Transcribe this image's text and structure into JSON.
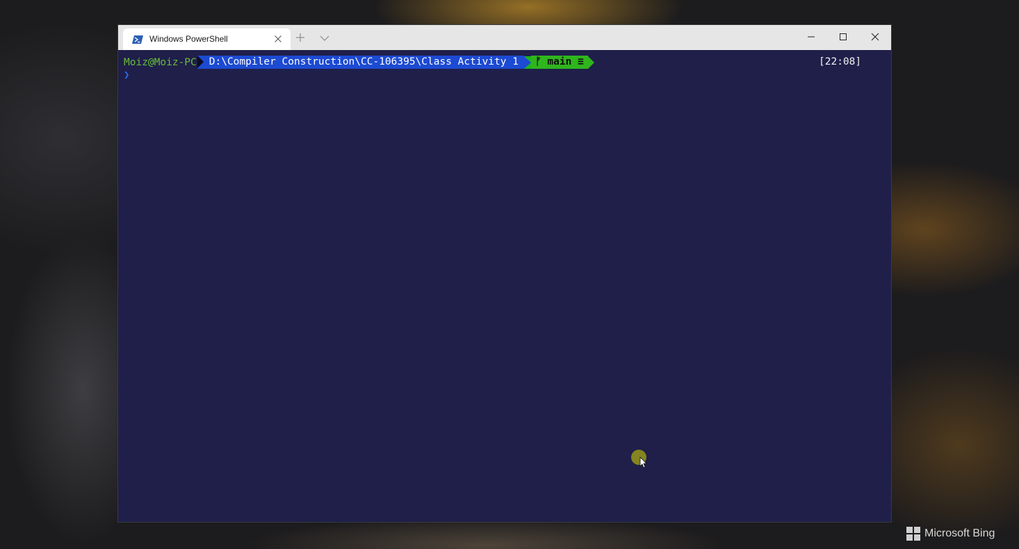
{
  "window": {
    "tab_title": "Windows PowerShell",
    "tab_icon": "powershell-icon",
    "new_tab_icon": "plus-icon",
    "dropdown_icon": "chevron-down-icon",
    "controls": {
      "minimize_icon": "minimize-icon",
      "maximize_icon": "maximize-icon",
      "close_icon": "close-icon"
    }
  },
  "terminal": {
    "user_host": "Moiz@Moiz-PC",
    "path": "D:\\Compiler Construction\\CC-106395\\Class Activity 1",
    "git_branch": "ᚠ main ≡",
    "time": "[22:08]",
    "prompt_symbol": "❯",
    "colors": {
      "background": "#1f1f4a",
      "user": "#6abe3a",
      "path_segment": "#1c4ad2",
      "git_segment": "#2fb51d",
      "prompt": "#2b6cf0"
    }
  },
  "desktop": {
    "watermark": "Microsoft Bing",
    "watermark_icon": "windows-logo-icon"
  }
}
